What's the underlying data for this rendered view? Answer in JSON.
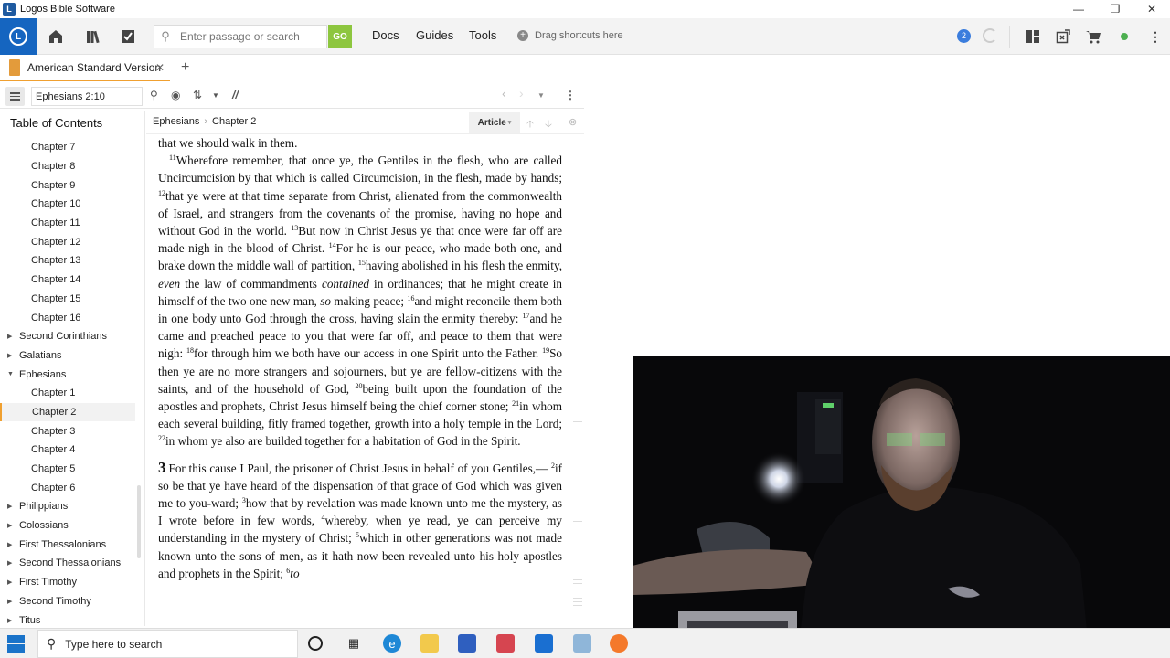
{
  "window": {
    "title": "Logos Bible Software",
    "controls": [
      "—",
      "❐",
      "✕"
    ]
  },
  "toolbar": {
    "search_placeholder": "Enter passage or search",
    "go_label": "GO",
    "menu": [
      "Docs",
      "Guides",
      "Tools"
    ],
    "shortcuts_label": "Drag shortcuts here",
    "notification_count": "2"
  },
  "tab": {
    "label": "American Standard Version",
    "close": "✕",
    "add": "+"
  },
  "panel": {
    "reference": "Ephesians 2:10",
    "parallel_label": "//"
  },
  "toc": {
    "title": "Table of Contents",
    "items": [
      {
        "label": "Chapter 7",
        "kind": "chapter"
      },
      {
        "label": "Chapter 8",
        "kind": "chapter"
      },
      {
        "label": "Chapter 9",
        "kind": "chapter"
      },
      {
        "label": "Chapter 10",
        "kind": "chapter"
      },
      {
        "label": "Chapter 11",
        "kind": "chapter"
      },
      {
        "label": "Chapter 12",
        "kind": "chapter"
      },
      {
        "label": "Chapter 13",
        "kind": "chapter"
      },
      {
        "label": "Chapter 14",
        "kind": "chapter"
      },
      {
        "label": "Chapter 15",
        "kind": "chapter"
      },
      {
        "label": "Chapter 16",
        "kind": "chapter"
      },
      {
        "label": "Second Corinthians",
        "kind": "book",
        "tri": "▶"
      },
      {
        "label": "Galatians",
        "kind": "book",
        "tri": "▶"
      },
      {
        "label": "Ephesians",
        "kind": "book",
        "tri": "▼"
      },
      {
        "label": "Chapter 1",
        "kind": "chapter"
      },
      {
        "label": "Chapter 2",
        "kind": "chapter",
        "selected": true
      },
      {
        "label": "Chapter 3",
        "kind": "chapter"
      },
      {
        "label": "Chapter 4",
        "kind": "chapter"
      },
      {
        "label": "Chapter 5",
        "kind": "chapter"
      },
      {
        "label": "Chapter 6",
        "kind": "chapter"
      },
      {
        "label": "Philippians",
        "kind": "book",
        "tri": "▶"
      },
      {
        "label": "Colossians",
        "kind": "book",
        "tri": "▶"
      },
      {
        "label": "First Thessalonians",
        "kind": "book",
        "tri": "▶"
      },
      {
        "label": "Second Thessalonians",
        "kind": "book",
        "tri": "▶"
      },
      {
        "label": "First Timothy",
        "kind": "book",
        "tri": "▶"
      },
      {
        "label": "Second Timothy",
        "kind": "book",
        "tri": "▶"
      },
      {
        "label": "Titus",
        "kind": "book",
        "tri": "▶"
      }
    ]
  },
  "reader": {
    "breadcrumb": [
      "Ephesians",
      "Chapter 2"
    ],
    "view_mode": "Article",
    "passage": [
      {
        "type": "cont",
        "segments": [
          {
            "t": "that we should walk in them."
          }
        ]
      },
      {
        "type": "para",
        "segments": [
          {
            "v": "11"
          },
          {
            "t": "Wherefore remember, that once ye, the Gentiles in the flesh, who are called Uncircumcision by that which is called Circumcision, in the flesh, made by hands; "
          },
          {
            "v": "12"
          },
          {
            "t": "that ye were at that time separate from Christ, alienated from the commonwealth of Israel, and strangers from the covenants of the promise, having no hope and without God in the world. "
          },
          {
            "v": "13"
          },
          {
            "t": "But now in Christ Jesus ye that once were far off are made nigh in the blood of Christ. "
          },
          {
            "v": "14"
          },
          {
            "t": "For he is our peace, who made both one, and brake down the middle wall of partition, "
          },
          {
            "v": "15"
          },
          {
            "t": "having abolished in his flesh the enmity, "
          },
          {
            "i": "even"
          },
          {
            "t": " the law of commandments "
          },
          {
            "i": "contained"
          },
          {
            "t": " in ordinances; that he might create in himself of the two one new man, "
          },
          {
            "i": "so"
          },
          {
            "t": " making peace; "
          },
          {
            "v": "16"
          },
          {
            "t": "and might reconcile them both in one body unto God through the cross, having slain the enmity thereby: "
          },
          {
            "v": "17"
          },
          {
            "t": "and he came and preached peace to you that were far off, and peace to them that were nigh: "
          },
          {
            "v": "18"
          },
          {
            "t": "for through him we both have our access in one Spirit unto the Father. "
          },
          {
            "v": "19"
          },
          {
            "t": "So then ye are no more strangers and sojourners, but ye are fellow-citizens with the saints, and of the household of God, "
          },
          {
            "v": "20"
          },
          {
            "t": "being built upon the foundation of the apostles and prophets, Christ Jesus himself being the chief corner stone; "
          },
          {
            "v": "21"
          },
          {
            "t": "in whom each several building, fitly framed together, growth into a holy temple in the Lord; "
          },
          {
            "v": "22"
          },
          {
            "t": "in whom ye also are builded together for a habitation of God in the Spirit."
          }
        ]
      },
      {
        "type": "chap",
        "chapter": "3",
        "segments": [
          {
            "t": "For this cause I Paul, the prisoner of Christ Jesus in behalf of you Gentiles,— "
          },
          {
            "v": "2"
          },
          {
            "t": "if so be that ye have heard of the dispensation of that grace of God which was given me to you-ward; "
          },
          {
            "v": "3"
          },
          {
            "t": "how that by revelation was made known unto me the mystery, as I wrote before in few words, "
          },
          {
            "v": "4"
          },
          {
            "t": "whereby, when ye read, ye can perceive my understanding in the mystery of Christ; "
          },
          {
            "v": "5"
          },
          {
            "t": "which in other generations was not made known unto the sons of men, as it hath now been revealed unto his holy apostles and prophets in the Spirit; "
          },
          {
            "v": "6"
          },
          {
            "i": "to"
          }
        ]
      }
    ]
  },
  "taskbar": {
    "search_placeholder": "Type here to search"
  }
}
